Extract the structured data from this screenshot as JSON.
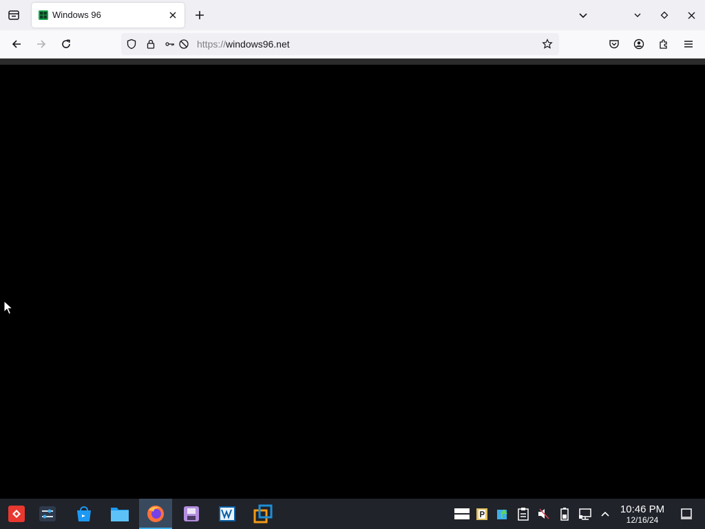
{
  "browser": {
    "tab": {
      "title": "Windows 96"
    },
    "url": {
      "scheme": "https://",
      "host": "windows96.net"
    }
  },
  "taskbar": {
    "apps": [
      {
        "icon": "kde-launcher-icon"
      },
      {
        "icon": "system-settings-icon"
      },
      {
        "icon": "discover-store-icon"
      },
      {
        "icon": "file-manager-icon"
      },
      {
        "icon": "firefox-icon",
        "active": true
      },
      {
        "icon": "floppy-app-icon"
      },
      {
        "icon": "vm-monitor-icon"
      },
      {
        "icon": "virtualbox-icon"
      }
    ],
    "clock": {
      "time": "10:46 PM",
      "date": "12/16/24"
    }
  },
  "colors": {
    "accent": "#3daee9",
    "taskbar": "#20232a",
    "tab_strip": "#f0f0f4"
  }
}
